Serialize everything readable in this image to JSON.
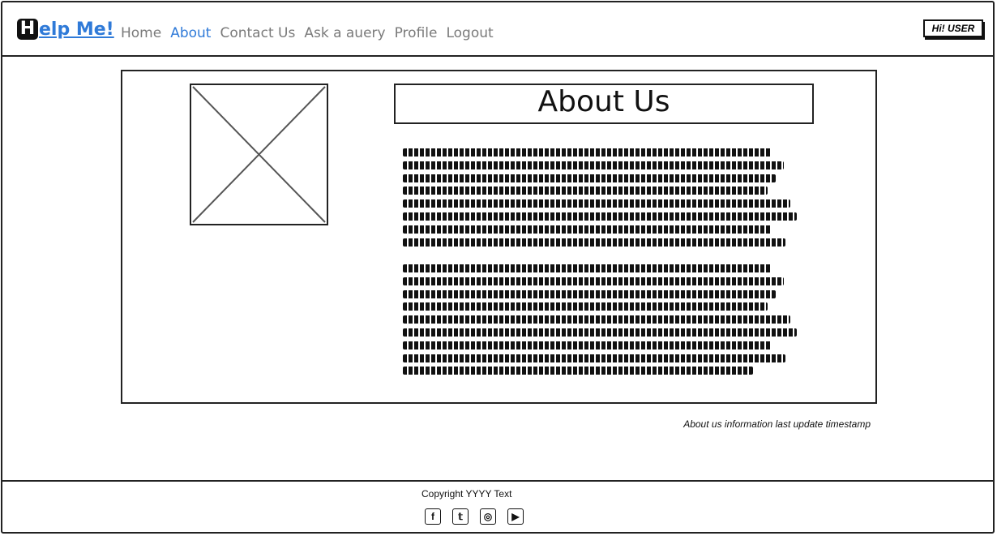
{
  "header": {
    "logo_mark": "H",
    "logo_text": "elp Me!",
    "nav": [
      "Home",
      "About",
      "Contact Us",
      "Ask a auery",
      "Profile",
      "Logout"
    ],
    "active_nav": "About",
    "user_badge": "Hi! USER"
  },
  "main": {
    "title": "About Us",
    "image_placeholder_icon": "image-placeholder-icon",
    "paragraph_1_lines": 8,
    "paragraph_2_lines": 9,
    "timestamp": "About us information last update timestamp"
  },
  "footer": {
    "copyright": "Copyright YYYY Text",
    "social": [
      {
        "name": "facebook-icon",
        "glyph": "f"
      },
      {
        "name": "twitter-icon",
        "glyph": "𝕥"
      },
      {
        "name": "instagram-icon",
        "glyph": "◎"
      },
      {
        "name": "youtube-icon",
        "glyph": "▶"
      }
    ]
  }
}
